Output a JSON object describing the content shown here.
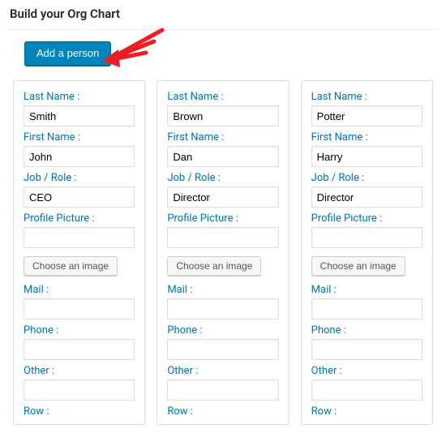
{
  "page": {
    "title": "Build your Org Chart"
  },
  "toolbar": {
    "add_label": "Add a person"
  },
  "labels": {
    "last_name": "Last Name :",
    "first_name": "First Name :",
    "job": "Job / Role :",
    "picture": "Profile Picture :",
    "choose_image": "Choose an image",
    "mail": "Mail :",
    "phone": "Phone :",
    "other": "Other :",
    "row": "Row :"
  },
  "people": [
    {
      "last_name": "Smith",
      "first_name": "John",
      "job": "CEO",
      "picture": "",
      "mail": "",
      "phone": "",
      "other": ""
    },
    {
      "last_name": "Brown",
      "first_name": "Dan",
      "job": "Director",
      "picture": "",
      "mail": "",
      "phone": "",
      "other": ""
    },
    {
      "last_name": "Potter",
      "first_name": "Harry",
      "job": "Director",
      "picture": "",
      "mail": "",
      "phone": "",
      "other": ""
    }
  ]
}
